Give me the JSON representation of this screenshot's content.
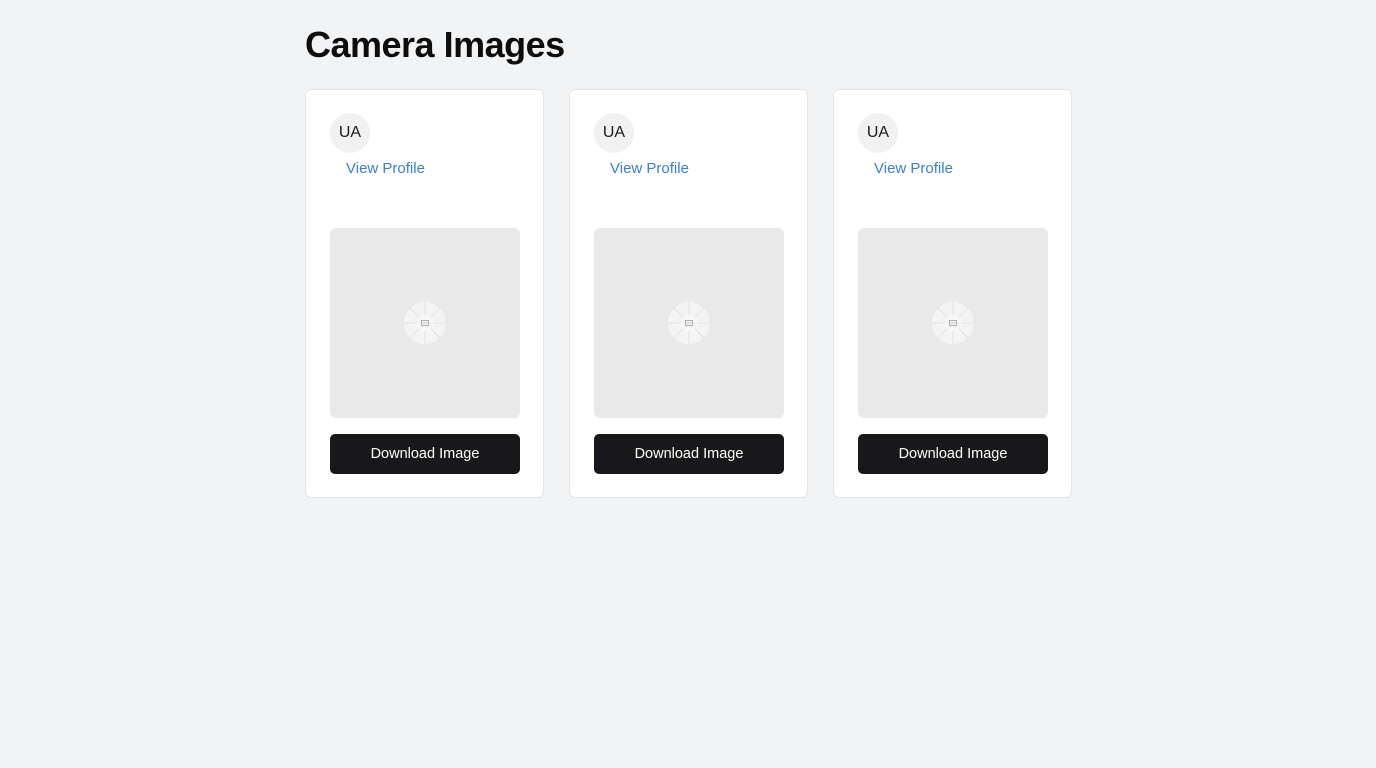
{
  "page": {
    "title": "Camera Images"
  },
  "cards": [
    {
      "avatar_initials": "UA",
      "profile_link_label": "View Profile",
      "image_icon": "image-placeholder-icon",
      "download_label": "Download Image"
    },
    {
      "avatar_initials": "UA",
      "profile_link_label": "View Profile",
      "image_icon": "image-placeholder-icon",
      "download_label": "Download Image"
    },
    {
      "avatar_initials": "UA",
      "profile_link_label": "View Profile",
      "image_icon": "image-placeholder-icon",
      "download_label": "Download Image"
    }
  ],
  "colors": {
    "page_background": "#f2f3f5",
    "card_background": "#ffffff",
    "link": "#3d7fd1",
    "button_background": "#18181b",
    "button_text": "#ffffff",
    "image_placeholder": "#e9e9ea"
  }
}
